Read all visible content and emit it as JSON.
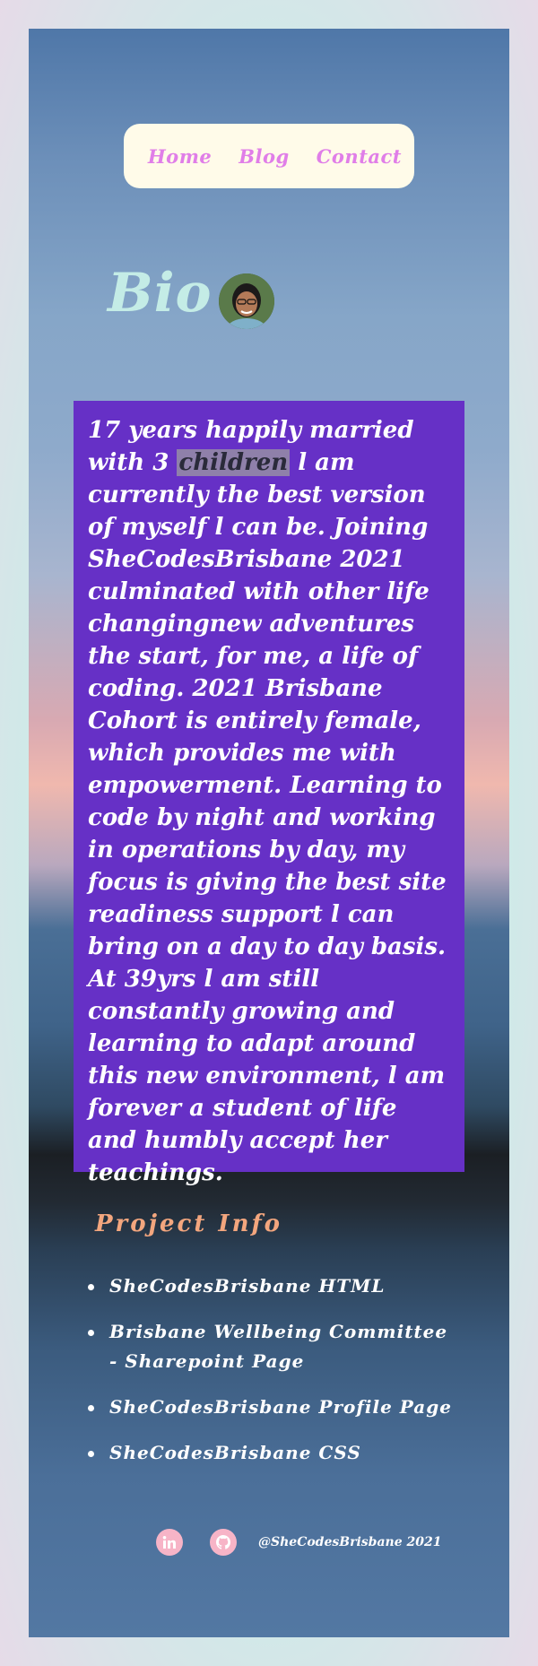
{
  "nav": {
    "items": [
      {
        "label": "Home"
      },
      {
        "label": "Blog"
      },
      {
        "label": "Contact"
      }
    ]
  },
  "bio": {
    "title": "Bio",
    "text_before": "17 years happily married with 3 ",
    "highlight": "children",
    "text_after": " l am currently the best version of myself l can be. Joining SheCodesBrisbane 2021 culminated with other life changingnew adventures the start, for me, a life of coding. 2021 Brisbane Cohort is entirely female, which provides me with empowerment. Learning to code by night and working in operations by day, my focus is giving the best site readiness support l can bring on a day to day basis. At 39yrs l am still constantly growing and learning to adapt around this new environment, l am forever a student of life and humbly accept her teachings."
  },
  "projects": {
    "title": "Project Info",
    "items": [
      {
        "label": "SheCodesBrisbane HTML"
      },
      {
        "label": "Brisbane Wellbeing Committee - Sharepoint Page"
      },
      {
        "label": "SheCodesBrisbane Profile Page"
      },
      {
        "label": "SheCodesBrisbane CSS"
      }
    ]
  },
  "footer": {
    "icons": [
      "linkedin-icon",
      "github-icon"
    ],
    "handle": "@SheCodesBrisbane 2021"
  },
  "colors": {
    "nav_bg": "#fffbe9",
    "nav_link": "#e07ee8",
    "bio_title": "#c4ece6",
    "card_bg": "#6630c6",
    "project_title": "#f3a67e",
    "footer_icon_bg": "#f7b4c7"
  }
}
